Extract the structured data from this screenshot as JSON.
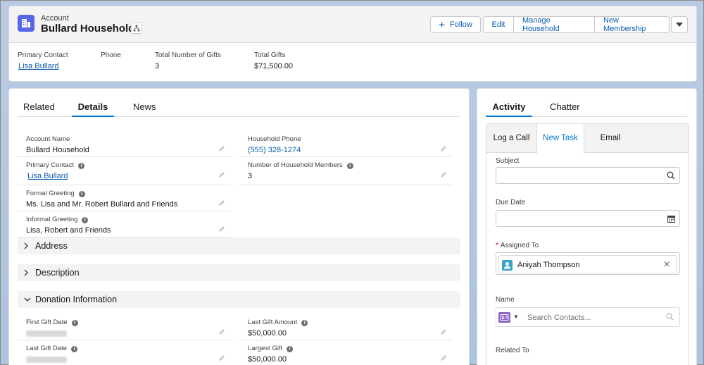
{
  "header": {
    "object_label": "Account",
    "record_name": "Bullard Household",
    "actions": {
      "follow": "Follow",
      "edit": "Edit",
      "manage_household": "Manage Household",
      "new_membership": "New Membership"
    },
    "highlights": [
      {
        "label": "Primary Contact",
        "value": "Lisa Bullard"
      },
      {
        "label": "Phone",
        "value": ""
      },
      {
        "label": "Total Number of Gifts",
        "value": "3"
      },
      {
        "label": "Total Gifts",
        "value": "$71,500.00"
      }
    ]
  },
  "details": {
    "tabs": [
      "Related",
      "Details",
      "News"
    ],
    "active_tab": "Details",
    "fields": {
      "account_name": {
        "label": "Account Name",
        "value": "Bullard Household"
      },
      "household_phone": {
        "label": "Household Phone",
        "value": "(555) 328-1274"
      },
      "primary_contact": {
        "label": "Primary Contact",
        "value": "Lisa Bullard"
      },
      "num_members": {
        "label": "Number of Household Members",
        "value": "3"
      },
      "formal_greeting": {
        "label": "Formal Greeting",
        "value": "Ms. Lisa and Mr. Robert Bullard and Friends"
      },
      "informal_greeting": {
        "label": "Informal Greeting",
        "value": "Lisa, Robert and Friends"
      },
      "first_gift_date": {
        "label": "First Gift Date",
        "value": ""
      },
      "last_gift_amount": {
        "label": "Last Gift Amount",
        "value": "$50,000.00"
      },
      "last_gift_date": {
        "label": "Last Gift Date",
        "value": ""
      },
      "largest_gift": {
        "label": "Largest Gift",
        "value": "$50,000.00"
      }
    },
    "sections": {
      "address": "Address",
      "description": "Description",
      "donation": "Donation Information"
    }
  },
  "activity": {
    "tabs": [
      "Activity",
      "Chatter"
    ],
    "active_tab": "Activity",
    "composer_tabs": [
      "Log a Call",
      "New Task",
      "Email"
    ],
    "active_composer_tab": "New Task",
    "subject_label": "Subject",
    "due_date_label": "Due Date",
    "assigned_to_label": "Assigned To",
    "assigned_to_value": "Aniyah Thompson",
    "name_label": "Name",
    "name_placeholder": "Search Contacts...",
    "related_to_label": "Related To"
  },
  "colors": {
    "brand": "#0176d3",
    "link": "#0b5cab",
    "account_icon": "#5867e8",
    "background": "#b0c4df"
  }
}
